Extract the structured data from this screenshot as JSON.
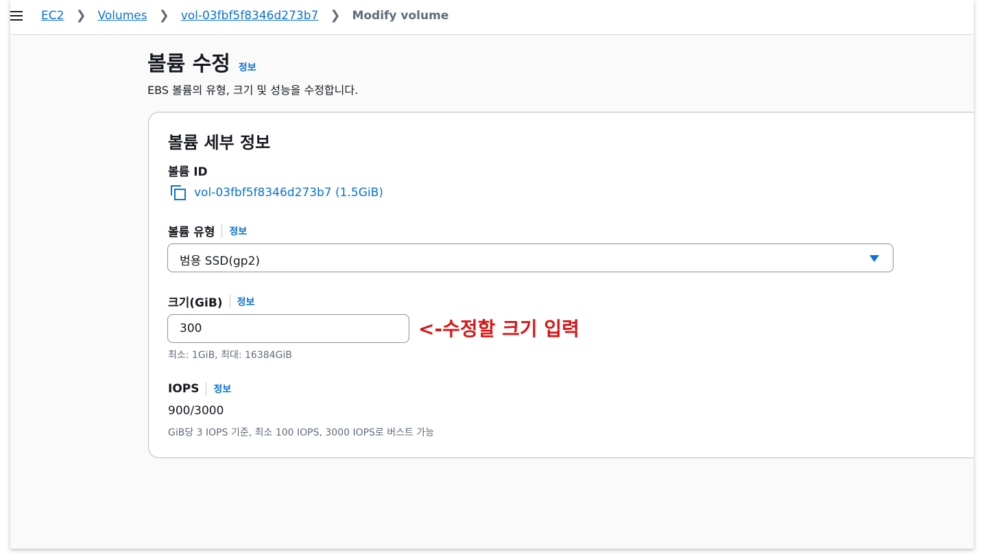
{
  "breadcrumb": {
    "items": [
      "EC2",
      "Volumes",
      "vol-03fbf5f8346d273b7"
    ],
    "current": "Modify volume"
  },
  "page": {
    "title": "볼륨 수정",
    "info": "정보",
    "description": "EBS 볼륨의 유형, 크기 및 성능을 수정합니다."
  },
  "card": {
    "title": "볼륨 세부 정보",
    "volume_id_label": "볼륨 ID",
    "volume_id_value": "vol-03fbf5f8346d273b7 (1.5GiB)",
    "volume_type_label": "볼륨 유형",
    "volume_type_info": "정보",
    "volume_type_value": "범용 SSD(gp2)",
    "size_label": "크기(GiB)",
    "size_info": "정보",
    "size_value": "300",
    "size_hint": "최소: 1GiB, 최대: 16384GiB",
    "annotation": "<-수정할 크기 입력",
    "iops_label": "IOPS",
    "iops_info": "정보",
    "iops_value": "900/3000",
    "iops_hint": "GiB당 3 IOPS 기준, 최소 100 IOPS, 3000 IOPS로 버스트 가능"
  },
  "icons": {
    "menu": "hamburger-menu-icon",
    "copy": "copy-icon",
    "dropdown": "caret-down-icon",
    "breadcrumb_separator": "chevron-right-icon"
  },
  "colors": {
    "link": "#0972d3",
    "annotation": "#d91515",
    "text": "#16191f",
    "muted": "#5f6b7a"
  }
}
